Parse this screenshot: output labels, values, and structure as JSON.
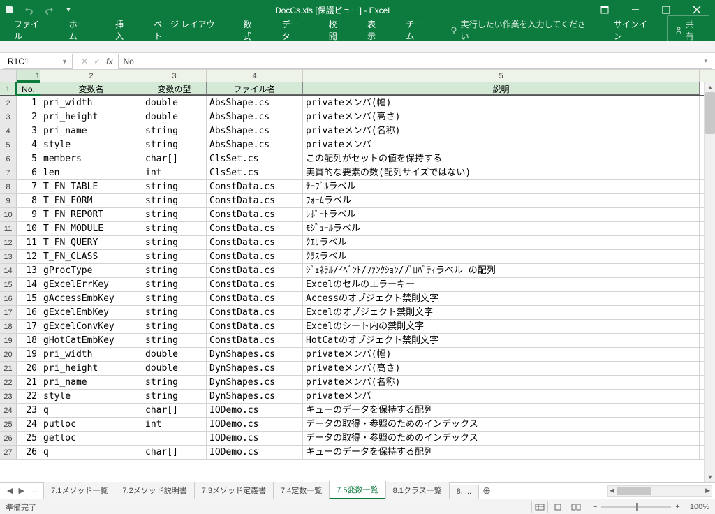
{
  "app": {
    "title": "DocCs.xls  [保護ビュー] - Excel"
  },
  "ribbon": {
    "tabs": [
      "ファイル",
      "ホーム",
      "挿入",
      "ページ レイアウト",
      "数式",
      "データ",
      "校閲",
      "表示",
      "チーム"
    ],
    "tellme": "実行したい作業を入力してください",
    "signin": "サインイン",
    "share": "共有"
  },
  "namebox": "R1C1",
  "formula": "No.",
  "col_headers": [
    "1",
    "2",
    "3",
    "4",
    "5"
  ],
  "table_header": [
    "No.",
    "変数名",
    "変数の型",
    "ファイル名",
    "説明"
  ],
  "rows": [
    {
      "n": "1",
      "v": [
        "1",
        "pri_width",
        "double",
        "AbsShape.cs",
        "privateメンバ(幅)"
      ]
    },
    {
      "n": "2",
      "v": [
        "2",
        "pri_height",
        "double",
        "AbsShape.cs",
        "privateメンバ(高さ)"
      ]
    },
    {
      "n": "3",
      "v": [
        "3",
        "pri_name",
        "string",
        "AbsShape.cs",
        "privateメンバ(名称)"
      ]
    },
    {
      "n": "4",
      "v": [
        "4",
        "style",
        "string",
        "AbsShape.cs",
        "privateメンバ"
      ]
    },
    {
      "n": "5",
      "v": [
        "5",
        "members",
        "char[]",
        "ClsSet.cs",
        "この配列がセットの値を保持する"
      ]
    },
    {
      "n": "6",
      "v": [
        "6",
        "len",
        "int",
        "ClsSet.cs",
        "実質的な要素の数(配列サイズではない)"
      ]
    },
    {
      "n": "7",
      "v": [
        "7",
        "T_FN_TABLE",
        "string",
        "ConstData.cs",
        "ﾃｰﾌﾞﾙラベル"
      ]
    },
    {
      "n": "8",
      "v": [
        "8",
        "T_FN_FORM",
        "string",
        "ConstData.cs",
        "ﾌｫｰﾑラベル"
      ]
    },
    {
      "n": "9",
      "v": [
        "9",
        "T_FN_REPORT",
        "string",
        "ConstData.cs",
        "ﾚﾎﾟｰﾄラベル"
      ]
    },
    {
      "n": "10",
      "v": [
        "10",
        "T_FN_MODULE",
        "string",
        "ConstData.cs",
        "ﾓｼﾞｭｰﾙラベル"
      ]
    },
    {
      "n": "11",
      "v": [
        "11",
        "T_FN_QUERY",
        "string",
        "ConstData.cs",
        "ｸｴﾘラベル"
      ]
    },
    {
      "n": "12",
      "v": [
        "12",
        "T_FN_CLASS",
        "string",
        "ConstData.cs",
        "ｸﾗｽラベル"
      ]
    },
    {
      "n": "13",
      "v": [
        "13",
        "gProcType",
        "string",
        "ConstData.cs",
        "ｼﾞｪﾈﾗﾙ/ｲﾍﾞﾝﾄ/ﾌｧﾝｸｼｮﾝ/ﾌﾟﾛﾊﾟﾃｨラベル の配列"
      ]
    },
    {
      "n": "14",
      "v": [
        "14",
        "gExcelErrKey",
        "string",
        "ConstData.cs",
        "Excelのセルのエラーキー"
      ]
    },
    {
      "n": "15",
      "v": [
        "15",
        "gAccessEmbKey",
        "string",
        "ConstData.cs",
        "Accessのオブジェクト禁則文字"
      ]
    },
    {
      "n": "16",
      "v": [
        "16",
        "gExcelEmbKey",
        "string",
        "ConstData.cs",
        "Excelのオブジェクト禁則文字"
      ]
    },
    {
      "n": "17",
      "v": [
        "17",
        "gExcelConvKey",
        "string",
        "ConstData.cs",
        "Excelのシート内の禁則文字"
      ]
    },
    {
      "n": "18",
      "v": [
        "18",
        "gHotCatEmbKey",
        "string",
        "ConstData.cs",
        "HotCatのオブジェクト禁則文字"
      ]
    },
    {
      "n": "19",
      "v": [
        "19",
        "pri_width",
        "double",
        "DynShapes.cs",
        "privateメンバ(幅)"
      ]
    },
    {
      "n": "20",
      "v": [
        "20",
        "pri_height",
        "double",
        "DynShapes.cs",
        "privateメンバ(高さ)"
      ]
    },
    {
      "n": "21",
      "v": [
        "21",
        "pri_name",
        "string",
        "DynShapes.cs",
        "privateメンバ(名称)"
      ]
    },
    {
      "n": "22",
      "v": [
        "22",
        "style",
        "string",
        "DynShapes.cs",
        "privateメンバ"
      ]
    },
    {
      "n": "23",
      "v": [
        "23",
        "q",
        "char[]",
        "IQDemo.cs",
        "キューのデータを保持する配列"
      ]
    },
    {
      "n": "24",
      "v": [
        "24",
        "putloc",
        "int",
        "IQDemo.cs",
        "データの取得・参照のためのインデックス"
      ]
    },
    {
      "n": "25",
      "v": [
        "25",
        "getloc",
        "",
        "IQDemo.cs",
        "データの取得・参照のためのインデックス"
      ]
    },
    {
      "n": "26",
      "v": [
        "26",
        "q",
        "char[]",
        "IQDemo.cs",
        "キューのデータを保持する配列"
      ]
    }
  ],
  "sheets": {
    "overflow_left": "...",
    "tabs": [
      "7.1メソッド一覧",
      "7.2メソッド説明書",
      "7.3メソッド定義書",
      "7.4定数一覧",
      "7.5変数一覧",
      "8.1クラス一覧",
      "8. ..."
    ],
    "active": "7.5変数一覧"
  },
  "status": {
    "ready": "準備完了",
    "zoom": "100%"
  }
}
